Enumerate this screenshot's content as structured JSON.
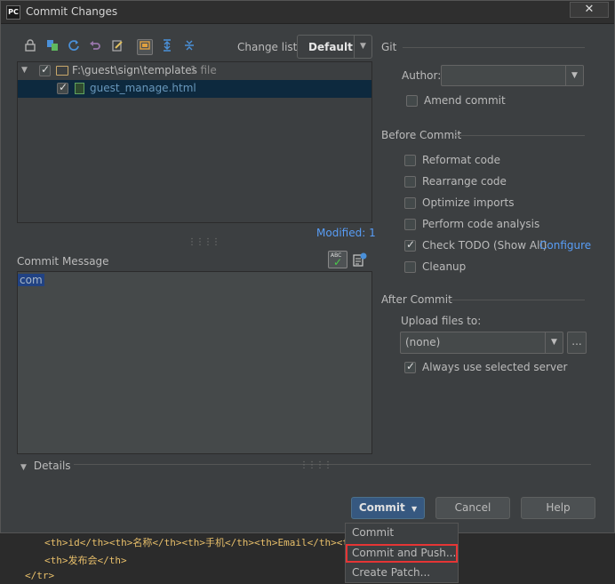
{
  "window": {
    "title": "Commit Changes",
    "app_logo": "PC",
    "close": "✕"
  },
  "toolbar": {
    "icons": [
      "vcs-icon",
      "diff-icon",
      "refresh-icon",
      "rollback-icon",
      "edit-icon",
      "group-icon",
      "expand-icon",
      "collapse-icon"
    ],
    "changelist_label": "Change list:",
    "changelist_value": "Default"
  },
  "tree": {
    "root_path": "F:\\guest\\sign\\templates",
    "root_count": "1 file",
    "file_name": "guest_manage.html"
  },
  "modified": "Modified: 1",
  "commit_message": {
    "label": "Commit Message",
    "text": "com"
  },
  "details_label": "Details",
  "git": {
    "section": "Git",
    "author_label": "Author:",
    "author_value": "",
    "amend_label": "Amend commit"
  },
  "before_commit": {
    "section": "Before Commit",
    "options": [
      {
        "label": "Reformat code",
        "checked": false
      },
      {
        "label": "Rearrange code",
        "checked": false
      },
      {
        "label": "Optimize imports",
        "checked": false
      },
      {
        "label": "Perform code analysis",
        "checked": false
      },
      {
        "label": "Check TODO (Show All)",
        "checked": true
      },
      {
        "label": "Cleanup",
        "checked": false
      }
    ],
    "configure_link": "Configure"
  },
  "after_commit": {
    "section": "After Commit",
    "upload_label": "Upload files to:",
    "upload_value": "(none)",
    "more_button": "...",
    "always_use_label": "Always use selected server"
  },
  "buttons": {
    "commit": "Commit",
    "cancel": "Cancel",
    "help": "Help"
  },
  "popup": {
    "items": [
      "Commit",
      "Commit and Push...",
      "Create Patch..."
    ]
  },
  "background_editor": {
    "line1": "<th>id</th><th>名称</th><th>手机</th><th>Email</th><th>签",
    "line2": "<th>发布会</th>",
    "line3": "</tr>"
  }
}
